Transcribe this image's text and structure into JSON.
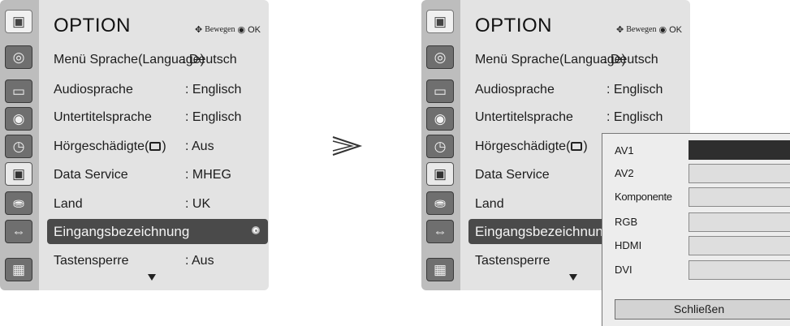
{
  "left": {
    "title": "OPTION",
    "nav_hint": "Bewegen",
    "ok": "OK",
    "rows": [
      {
        "label": "Menü Sprache(Language)",
        "value": ": Deutsch"
      },
      {
        "label": "Audiosprache",
        "value": ": Englisch"
      },
      {
        "label": "Untertitelsprache",
        "value": ": Englisch"
      },
      {
        "label_a": "Hörgeschädigte(",
        "label_b": ")",
        "value": ": Aus"
      },
      {
        "label": "Data Service",
        "value": ": MHEG"
      },
      {
        "label": "Land",
        "value": ": UK"
      },
      {
        "label": "Eingangsbezeichnung"
      },
      {
        "label": "Tastensperre",
        "value": ": Aus"
      }
    ]
  },
  "right": {
    "title": "OPTION",
    "nav_hint": "Bewegen",
    "ok": "OK",
    "rows": [
      {
        "label": "Menü Sprache(Language)",
        "value": ": Deutsch"
      },
      {
        "label": "Audiosprache",
        "value": ": Englisch"
      },
      {
        "label": "Untertitelsprache",
        "value": ": Englisch"
      },
      {
        "label_a": "Hörgeschädigte(",
        "label_b": ")"
      },
      {
        "label": "Data Service"
      },
      {
        "label": "Land"
      },
      {
        "label": "Eingangsbezeichnun"
      },
      {
        "label": "Tastensperre"
      }
    ]
  },
  "popup": {
    "items": [
      "AV1",
      "AV2",
      "Komponente",
      "RGB",
      "HDMI",
      "DVI"
    ],
    "selected_index": 0,
    "close_label": "Schließen"
  },
  "colors": {
    "highlight": "#4a4a4a",
    "panel": "#e3e3e3",
    "icon_column": "#bdbdbd"
  },
  "icons": [
    "option-menu-icon",
    "satellite-icon",
    "screen-icon",
    "speaker-icon",
    "clock-icon",
    "option-icon",
    "lock-icon",
    "plug-icon",
    "photo-icon"
  ]
}
